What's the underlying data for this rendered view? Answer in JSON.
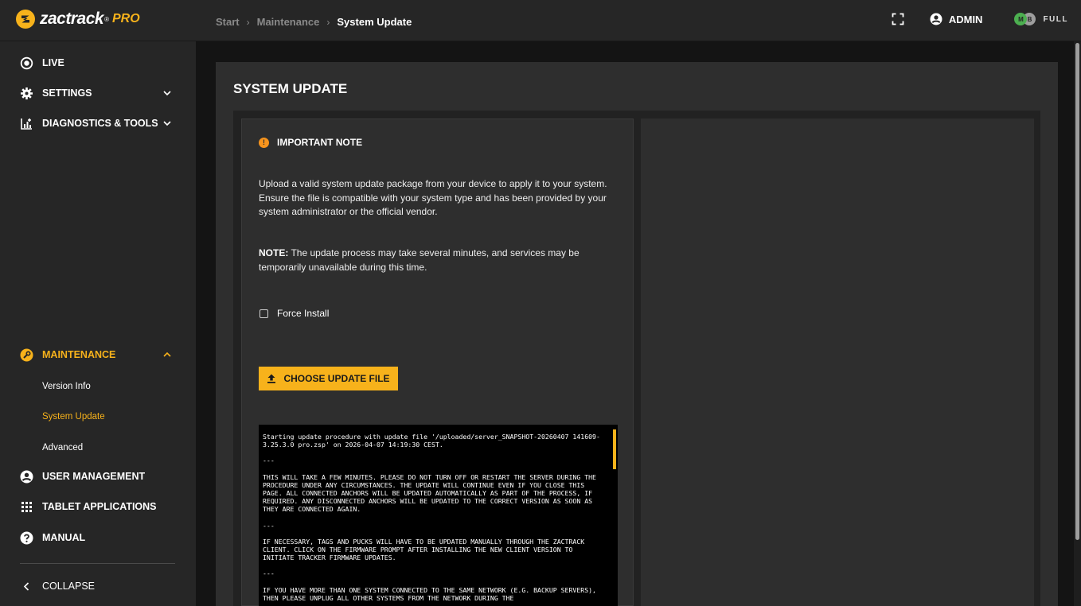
{
  "app": {
    "logo_text": "zactrack",
    "logo_sup": "®",
    "logo_pro": "PRO"
  },
  "breadcrumb": [
    "Start",
    "Maintenance",
    "System Update"
  ],
  "header": {
    "user_label": "ADMIN",
    "license_m": "M",
    "license_b": "B",
    "license_label": "FULL"
  },
  "sidebar": {
    "items": [
      {
        "label": "LIVE",
        "icon": "live-icon"
      },
      {
        "label": "SETTINGS",
        "icon": "gear-icon"
      },
      {
        "label": "DIAGNOSTICS & TOOLS",
        "icon": "diagnostics-icon"
      },
      {
        "label": "MAINTENANCE",
        "icon": "maintenance-icon"
      },
      {
        "label": "USER MANAGEMENT",
        "icon": "user-circle-icon"
      },
      {
        "label": "TABLET APPLICATIONS",
        "icon": "grid-icon"
      },
      {
        "label": "MANUAL",
        "icon": "help-icon"
      }
    ],
    "maintenance_sub": [
      "Version Info",
      "System Update",
      "Advanced"
    ],
    "collapse_label": "COLLAPSE"
  },
  "page": {
    "title": "SYSTEM UPDATE",
    "note_title": "IMPORTANT NOTE",
    "paragraph": "Upload a valid system update package from your device to apply it to your system. Ensure the file is compatible with your system type and has been provided by your system administrator or the official vendor.",
    "note_prefix": "NOTE:",
    "note_text": " The update process may take several minutes, and services may be temporarily unavailable during this time.",
    "force_install_label": "Force Install",
    "upload_button": "CHOOSE UPDATE FILE"
  },
  "terminal": {
    "lines": [
      "Starting update procedure with update file '/uploaded/server_SNAPSHOT-20260407 141609-3.25.3.0 pro.zsp' on 2026-04-07 14:19:30 CEST.",
      "---",
      "THIS WILL TAKE A FEW MINUTES. PLEASE DO NOT TURN OFF OR RESTART THE SERVER DURING THE PROCEDURE UNDER ANY CIRCUMSTANCES. THE UPDATE WILL CONTINUE EVEN IF YOU CLOSE THIS PAGE. ALL CONNECTED ANCHORS WILL BE UPDATED AUTOMATICALLY AS PART OF THE PROCESS, IF REQUIRED. ANY DISCONNECTED ANCHORS WILL BE UPDATED TO THE CORRECT VERSION AS SOON AS THEY ARE CONNECTED AGAIN.",
      "---",
      "IF NECESSARY, TAGS AND PUCKS WILL HAVE TO BE UPDATED MANUALLY THROUGH THE ZACTRACK CLIENT. CLICK ON THE FIRMWARE PROMPT AFTER INSTALLING THE NEW CLIENT VERSION TO INITIATE TRACKER FIRMWARE UPDATES.",
      "---",
      "IF YOU HAVE MORE THAN ONE SYSTEM CONNECTED TO THE SAME NETWORK (E.G. BACKUP SERVERS), THEN PLEASE UNPLUG ALL OTHER SYSTEMS FROM THE NETWORK DURING THE"
    ]
  },
  "colors": {
    "accent": "#f7b21b",
    "background": "#141414",
    "panel": "#2e2e2e",
    "sidebar": "#262626"
  }
}
